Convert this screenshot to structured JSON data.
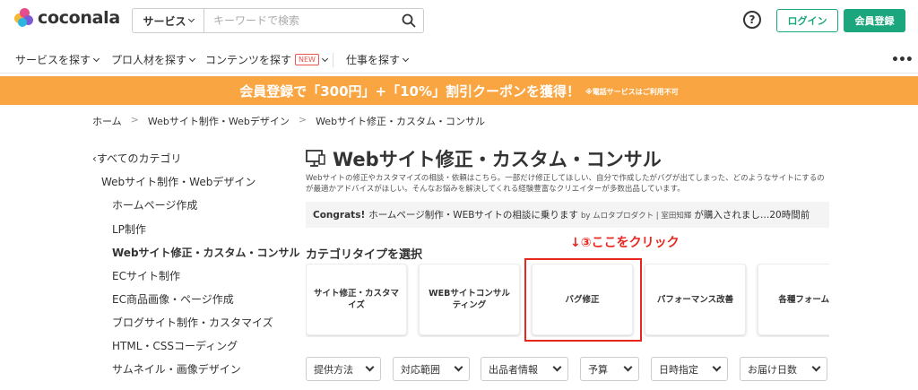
{
  "header": {
    "logo_text": "coconala",
    "search_category": "サービス",
    "search_placeholder": "キーワードで検索",
    "help_glyph": "?",
    "login_label": "ログイン",
    "register_label": "会員登録"
  },
  "nav": {
    "items": [
      {
        "label": "サービスを探す"
      },
      {
        "label": "プロ人材を探す"
      },
      {
        "label": "コンテンツを探す",
        "badge": "NEW"
      },
      {
        "label": "仕事を探す"
      }
    ],
    "more_glyph": "•••"
  },
  "banner": {
    "main": "会員登録で「300円」+「10%」割引クーポンを獲得！",
    "note": "※電話サービスはご利用不可",
    "color": "#f9a541"
  },
  "breadcrumb": [
    "ホーム",
    "Webサイト制作・Webデザイン",
    "Webサイト修正・カスタム・コンサル"
  ],
  "breadcrumb_sep": ">",
  "sidebar": {
    "back_label": "すべてのカテゴリ",
    "parent": "Webサイト制作・Webデザイン",
    "items": [
      {
        "label": "ホームページ作成"
      },
      {
        "label": "LP制作"
      },
      {
        "label": "Webサイト修正・カスタム・コンサル"
      },
      {
        "label": "ECサイト制作"
      },
      {
        "label": "EC商品画像・ページ作成"
      },
      {
        "label": "ブログサイト制作・カスタマイズ"
      },
      {
        "label": "HTML・CSSコーディング"
      },
      {
        "label": "サムネイル・画像デザイン"
      }
    ]
  },
  "main": {
    "title": "Webサイト修正・カスタム・コンサル",
    "description": "Webサイトの修正やカスタマイズの相談・依頼はこちら。一部だけ修正してほしい、自分で作成したがバグが出てしまった、どのようなサイトにするのが最適かアドバイスがほしい。そんなお悩みを解決してくれる経験豊富なクリエイターが多数出品しています。",
    "congrats": {
      "label": "Congrats!",
      "service": "ホームページ制作・WEBサイトの相談に乗ります",
      "by": "by ムロタプロダクト | 室田知輝",
      "suffix": "が購入されまし…20時間前"
    },
    "annotation": "↓③ここをクリック",
    "category_type_title": "カテゴリタイプを選択",
    "category_cards": [
      {
        "label": "サイト修正・カスタマイズ"
      },
      {
        "label": "WEBサイトコンサルティング"
      },
      {
        "label": "バグ修正"
      },
      {
        "label": "パフォーマンス改善"
      },
      {
        "label": "各種フォーム・"
      }
    ],
    "filters": [
      {
        "label": "提供方法"
      },
      {
        "label": "対応範囲"
      },
      {
        "label": "出品者情報"
      },
      {
        "label": "予算"
      },
      {
        "label": "日時指定"
      },
      {
        "label": "お届け日数"
      }
    ]
  },
  "colors": {
    "brand_green": "#1ca67d",
    "annotation_red": "#e8261e"
  }
}
